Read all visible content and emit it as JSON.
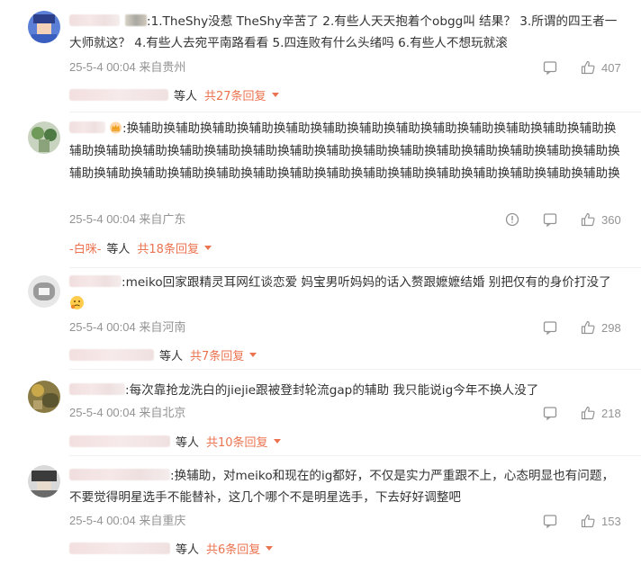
{
  "comments": [
    {
      "text": ":1.TheShy没惹 TheShy辛苦了 2.有些人天天抱着个obgg叫 结果？ 3.所谓的四王者一大师就这？ 4.有些人去宛平南路看看 5.四连败有什么头绪吗 6.有些人不想玩就滚",
      "time": "25-5-4 00:04",
      "location": "来自贵州",
      "likes": "407",
      "reply_suffix": "等人",
      "reply_total": "共27条回复"
    },
    {
      "text": ":换辅助换辅助换辅助换辅助换辅助换辅助换辅助换辅助换辅助换辅助换辅助换辅助换辅助换辅助换辅助换辅助换辅助换辅助换辅助换辅助换辅助换辅助换辅助换辅助换辅助换辅助换辅助换辅助换辅助换辅助换辅助换辅助换辅助换辅助换辅助换辅助换辅助换辅助换辅助换辅助换辅助换辅助换辅助换",
      "time": "25-5-4 00:04",
      "location": "来自广东",
      "likes": "360",
      "reply_name": "-白咪-",
      "reply_suffix": "等人",
      "reply_total": "共18条回复"
    },
    {
      "text": ":meiko回家跟精灵耳网红谈恋爱 妈宝男听妈妈的话入赘跟嬷嬷结婚 别把仅有的身价打没了",
      "time": "25-5-4 00:04",
      "location": "来自河南",
      "likes": "298",
      "reply_suffix": "等人",
      "reply_total": "共7条回复"
    },
    {
      "text": ":每次靠抢龙洗白的jiejie跟被登封轮流gap的辅助 我只能说ig今年不换人没了",
      "time": "25-5-4 00:04",
      "location": "来自北京",
      "likes": "218",
      "reply_suffix": "等人",
      "reply_total": "共10条回复"
    },
    {
      "text": ":换辅助，对meiko和现在的ig都好，不仅是实力严重跟不上，心态明显也有问题，不要觉得明星选手不能替补，这几个哪个不是明星选手，下去好好调整吧",
      "time": "25-5-4 00:04",
      "location": "来自重庆",
      "likes": "153",
      "reply_suffix": "等人",
      "reply_total": "共6条回复"
    }
  ],
  "colors": {
    "accent": "#eb7350",
    "meta": "#939393",
    "text": "#333333"
  },
  "icons": [
    "report-icon",
    "comment-icon",
    "like-icon",
    "caret-down-icon"
  ]
}
